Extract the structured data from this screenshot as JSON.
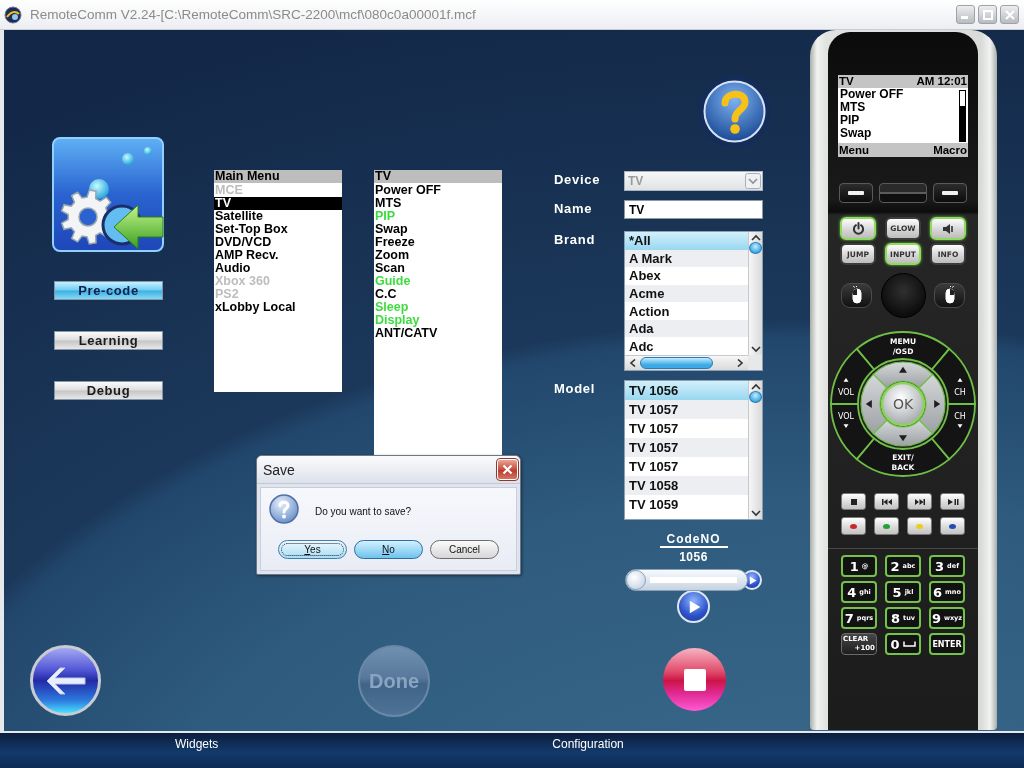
{
  "window": {
    "title": "RemoteComm V2.24-[C:\\RemoteComm\\SRC-2200\\mcf\\080c0a00001f.mcf"
  },
  "mode_buttons": [
    {
      "label": "Pre-code",
      "selected": true
    },
    {
      "label": "Learning",
      "selected": false
    },
    {
      "label": "Debug",
      "selected": false
    }
  ],
  "main_menu": {
    "title": "Main Menu",
    "items": [
      {
        "label": "MCE",
        "selected": false,
        "disabled": true
      },
      {
        "label": "TV",
        "selected": true,
        "disabled": false
      },
      {
        "label": "Satellite",
        "selected": false,
        "disabled": false
      },
      {
        "label": "Set-Top Box",
        "selected": false,
        "disabled": false
      },
      {
        "label": "DVD/VCD",
        "selected": false,
        "disabled": false
      },
      {
        "label": "AMP Recv.",
        "selected": false,
        "disabled": false
      },
      {
        "label": "Audio",
        "selected": false,
        "disabled": false
      },
      {
        "label": "Xbox 360",
        "selected": false,
        "disabled": true
      },
      {
        "label": "PS2",
        "selected": false,
        "disabled": true
      },
      {
        "label": "xLobby Local",
        "selected": false,
        "disabled": false
      }
    ]
  },
  "function_list": {
    "title": "TV",
    "items": [
      {
        "label": "Power OFF",
        "color": "#000000"
      },
      {
        "label": "MTS",
        "color": "#000000"
      },
      {
        "label": "PIP",
        "color": "#3ddc3d"
      },
      {
        "label": "Swap",
        "color": "#000000"
      },
      {
        "label": "Freeze",
        "color": "#000000"
      },
      {
        "label": "Zoom",
        "color": "#000000"
      },
      {
        "label": "Scan",
        "color": "#000000"
      },
      {
        "label": "Guide",
        "color": "#3ddc3d"
      },
      {
        "label": "C.C",
        "color": "#000000"
      },
      {
        "label": "Sleep",
        "color": "#3ddc3d"
      },
      {
        "label": "Display",
        "color": "#3ddc3d"
      },
      {
        "label": "ANT/CATV",
        "color": "#000000"
      }
    ]
  },
  "form": {
    "device": {
      "label": "Device",
      "value": "TV",
      "disabled": true
    },
    "name": {
      "label": "Name",
      "value": "TV"
    },
    "brand": {
      "label": "Brand",
      "items": [
        {
          "label": "*All",
          "selected": true
        },
        {
          "label": "A Mark",
          "selected": false
        },
        {
          "label": "Abex",
          "selected": false
        },
        {
          "label": "Acme",
          "selected": false
        },
        {
          "label": "Action",
          "selected": false
        },
        {
          "label": "Ada",
          "selected": false
        },
        {
          "label": "Adc",
          "selected": false
        }
      ]
    },
    "model": {
      "label": "Model",
      "items": [
        {
          "label": "TV 1056",
          "selected": true
        },
        {
          "label": "TV 1057",
          "selected": false
        },
        {
          "label": "TV 1057",
          "selected": false
        },
        {
          "label": "TV 1057",
          "selected": false
        },
        {
          "label": "TV 1057",
          "selected": false
        },
        {
          "label": "TV 1058",
          "selected": false
        },
        {
          "label": "TV 1059",
          "selected": false
        }
      ]
    },
    "code": {
      "label": "CodeNO",
      "value": "1056"
    },
    "slider": {
      "level": 0
    }
  },
  "bottom_buttons": [
    {
      "kind": "back",
      "disabled": false
    },
    {
      "kind": "done",
      "label": "Done",
      "disabled": true
    },
    {
      "kind": "stop",
      "disabled": false
    }
  ],
  "dialog": {
    "title": "Save",
    "message": "Do you want to save?",
    "buttons": [
      {
        "label": "Yes",
        "kind": "focused",
        "access_key": true
      },
      {
        "label": "No",
        "kind": "default",
        "access_key": true
      },
      {
        "label": "Cancel",
        "kind": "plain",
        "access_key": false
      }
    ]
  },
  "remote": {
    "screen": {
      "title": "TV",
      "clock": "AM 12:01",
      "items": [
        "Power OFF",
        "MTS",
        "PIP",
        "Swap"
      ],
      "left_softkey": "Menu",
      "right_softkey": "Macro"
    },
    "keys": [
      {
        "kind": "power",
        "glow": true
      },
      {
        "kind": "text",
        "label": "GLOW",
        "glow": false
      },
      {
        "kind": "mute",
        "glow": true
      },
      {
        "kind": "text",
        "label": "JUMP",
        "glow": false
      },
      {
        "kind": "text",
        "label": "INPUT",
        "glow": true
      },
      {
        "kind": "text",
        "label": "INFO",
        "glow": false
      }
    ],
    "dpad": {
      "top": [
        "MEMU",
        "/OSD"
      ],
      "bottom": [
        "EXIT/",
        "BACK"
      ],
      "center": "OK",
      "side_keys": [
        {
          "label": "VOL",
          "kind": "up"
        },
        {
          "label": "VOL",
          "kind": "down"
        },
        {
          "label": "CH",
          "kind": "up"
        },
        {
          "label": "CH",
          "kind": "down"
        }
      ]
    },
    "transport": [
      {
        "kind": "stop"
      },
      {
        "kind": "previous"
      },
      {
        "kind": "next"
      },
      {
        "kind": "play_pause"
      }
    ],
    "color_keys": [
      {
        "color": "#c8282c"
      },
      {
        "color": "#23a038"
      },
      {
        "color": "#e8cf1c"
      },
      {
        "color": "#1f4fb4"
      }
    ],
    "numpad": [
      {
        "kind": "digit",
        "digit": "1",
        "letters": "@"
      },
      {
        "kind": "digit",
        "digit": "2",
        "letters": "abc"
      },
      {
        "kind": "digit",
        "digit": "3",
        "letters": "def"
      },
      {
        "kind": "digit",
        "digit": "4",
        "letters": "ghi"
      },
      {
        "kind": "digit",
        "digit": "5",
        "letters": "jkl"
      },
      {
        "kind": "digit",
        "digit": "6",
        "letters": "mno"
      },
      {
        "kind": "digit",
        "digit": "7",
        "letters": "pqrs"
      },
      {
        "kind": "digit",
        "digit": "8",
        "letters": "tuv"
      },
      {
        "kind": "digit",
        "digit": "9",
        "letters": "wxyz"
      },
      {
        "kind": "clear",
        "label": "CLEAR",
        "sub": "+100"
      },
      {
        "kind": "space",
        "digit": "0"
      },
      {
        "kind": "enter",
        "label": "ENTER"
      }
    ]
  },
  "bottom_bar": {
    "tabs": [
      "Widgets",
      "Configuration"
    ]
  }
}
